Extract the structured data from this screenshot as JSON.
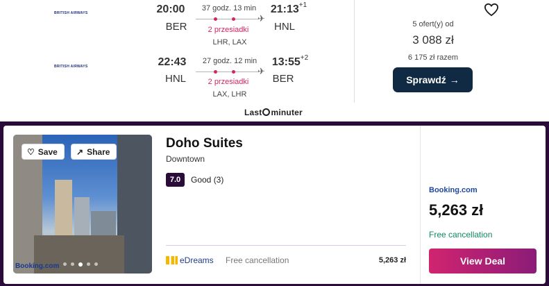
{
  "flight": {
    "outbound": {
      "airline": "BRITISH AIRWAYS",
      "dep_time": "20:00",
      "dep_code": "BER",
      "duration": "37 godz. 13 min",
      "stops": "2 przesiadki",
      "via": "LHR, LAX",
      "arr_time": "21:13",
      "arr_offset": "+1",
      "arr_code": "HNL"
    },
    "inbound": {
      "airline": "BRITISH AIRWAYS",
      "dep_time": "22:43",
      "dep_code": "HNL",
      "duration": "27 godz. 12 min",
      "stops": "2 przesiadki",
      "via": "LAX, LHR",
      "arr_time": "13:55",
      "arr_offset": "+2",
      "arr_code": "BER"
    },
    "offers_text": "5 ofert(y) od",
    "price": "3 088 zł",
    "total": "6 175 zł razem",
    "check_label": "Sprawdź",
    "provider_a": "Last",
    "provider_b": "minuter"
  },
  "hotel": {
    "save_label": "Save",
    "share_label": "Share",
    "photo_logo": "Booking.com",
    "name": "Doho Suites",
    "area": "Downtown",
    "score": "7.0",
    "score_text": "Good (3)",
    "alt_provider": "eDreams",
    "alt_cancel": "Free cancellation",
    "alt_price": "5,263 zł",
    "main_provider": "Booking.com",
    "main_price": "5,263 zł",
    "main_cancel": "Free cancellation",
    "deal_label": "View Deal"
  },
  "icons": [
    "heart-icon",
    "arrow-right-icon",
    "share-icon",
    "plane-icon",
    "clock-icon"
  ],
  "colors": {
    "accent": "#d6245c",
    "dark_button": "#102a43",
    "band": "#2b0b3a",
    "free": "#0f8a5f"
  }
}
